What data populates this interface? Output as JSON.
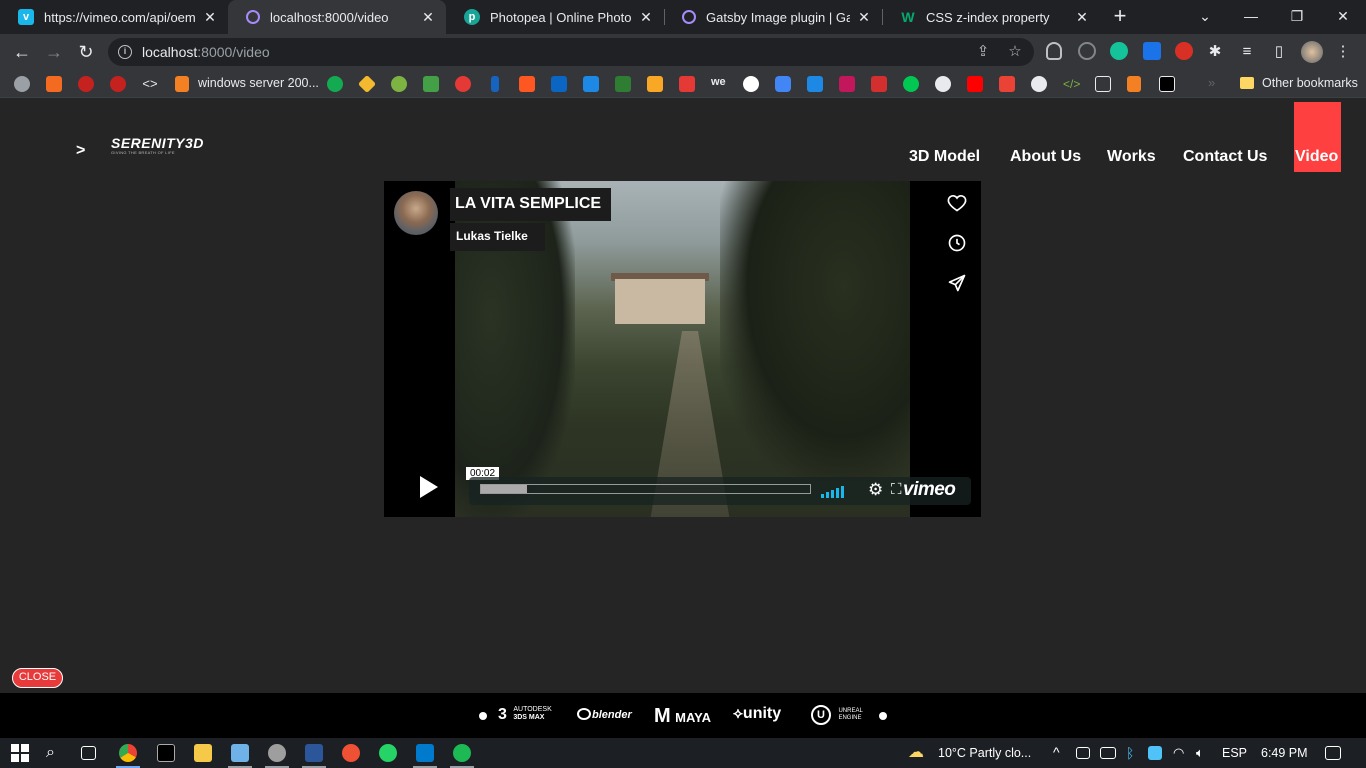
{
  "browser": {
    "tabs": [
      {
        "title": "https://vimeo.com/api/oemb",
        "favicon": "vimeo-icon",
        "color": "#1ab7ea"
      },
      {
        "title": "localhost:8000/video",
        "favicon": "gatsby-icon",
        "color": "#a78bfa"
      },
      {
        "title": "Photopea | Online Photo Edit",
        "favicon": "photopea-icon",
        "color": "#18a497"
      },
      {
        "title": "Gatsby Image plugin | Gatsby",
        "favicon": "gatsby-icon",
        "color": "#a78bfa"
      },
      {
        "title": "CSS z-index property",
        "favicon": "w3schools-icon",
        "color": "#04aa6d"
      }
    ],
    "url": {
      "host": "localhost",
      "path": ":8000/video"
    },
    "bookmarks_bar": {
      "text_item": "windows server 200...",
      "other": "Other bookmarks"
    }
  },
  "site": {
    "logo": {
      "name": "SERENITY3D",
      "tagline": "GIVING THE BREATH OF LIFE"
    },
    "arrow": ">",
    "nav": [
      "3D Model",
      "About Us",
      "Works",
      "Contact Us",
      "Video"
    ],
    "nav_active": "Video",
    "accent": "#ff4040"
  },
  "player": {
    "title": "LA VITA SEMPLICE",
    "author": "Lukas Tielke",
    "time": "00:02",
    "progress": 0.14,
    "brand": "vimeo",
    "side_icons": [
      "heart-icon",
      "clock-icon",
      "send-icon"
    ]
  },
  "close_button": "CLOSE",
  "brands": {
    "max": {
      "num": "3",
      "top": "AUTODESK",
      "bottom": "3DS MAX"
    },
    "blender": "blender",
    "maya": {
      "m": "M",
      "text": "MAYA"
    },
    "unity": "unity",
    "unreal": {
      "top": "UNREAL",
      "bottom": "ENGINE"
    }
  },
  "taskbar": {
    "weather": "10°C  Partly clo...",
    "lang": "ESP",
    "time": "6:49 PM"
  }
}
